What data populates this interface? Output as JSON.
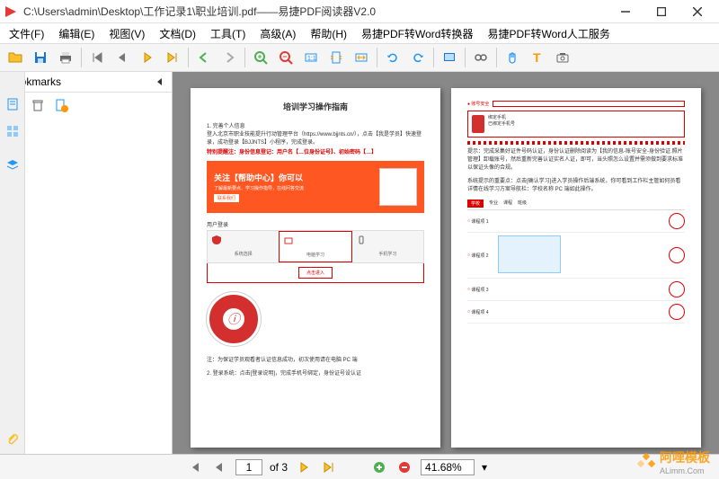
{
  "window": {
    "title": "C:\\Users\\admin\\Desktop\\工作记录1\\职业培训.pdf——易捷PDF阅读器V2.0"
  },
  "menu": {
    "file": "文件(F)",
    "edit": "编辑(E)",
    "view": "视图(V)",
    "document": "文档(D)",
    "tools": "工具(T)",
    "advanced": "高级(A)",
    "help": "帮助(H)",
    "converter": "易捷PDF转Word转换器",
    "service": "易捷PDF转Word人工服务"
  },
  "sidebar": {
    "title": "Bookmarks"
  },
  "status": {
    "page_current": "1",
    "page_label": "of 3",
    "zoom": "41.68%"
  },
  "doc": {
    "page1": {
      "title": "培训学习操作指南",
      "step1": "1. 完善个人信息",
      "step1_desc": "登入北京市职业技能提升行动管理平台（https://www.bjjnts.cn/），点击【我是学员】快速登录，成功登录【BJJNTS】小程序，完成登录。",
      "highlight": "特别提醒注：身份信息登记：用户名【…位身份证号】、初始密码【…】",
      "banner": "关注【帮助中心】你可以",
      "banner_sub": "了解最新要点、学习操作指导，在线问答交流",
      "tab1": "用户登录",
      "subtab1": "系统选择",
      "subtab2": "电脑学习",
      "subtab3": "手机学习",
      "step_note": "注：为保证学员观看者认证信息成功，初次使用请在电脑 PC 端",
      "step2": "2. 登录系统：点击[登录说明]，完成手机号绑定，身份证号设认证"
    },
    "page2": {
      "note": "提示：完成采集好证件号码认证，身份认证删除阅读为【我的信息-账号安全-身份验证.照片管理】卸载账号，然后重新完善认证实名人证，即可，当头照怎么设置并需须做到要求标准以保证头像的合规。",
      "note2": "系统提示的重要点：点击[确认学习]进入学员操作后端系统，你可看到工作栏主管如何员看详情在线学习方案导航栏：学校名称 PC 端如此操作。"
    }
  },
  "watermark": {
    "main": "阿哩模板",
    "sub": "ALimm.Com"
  }
}
